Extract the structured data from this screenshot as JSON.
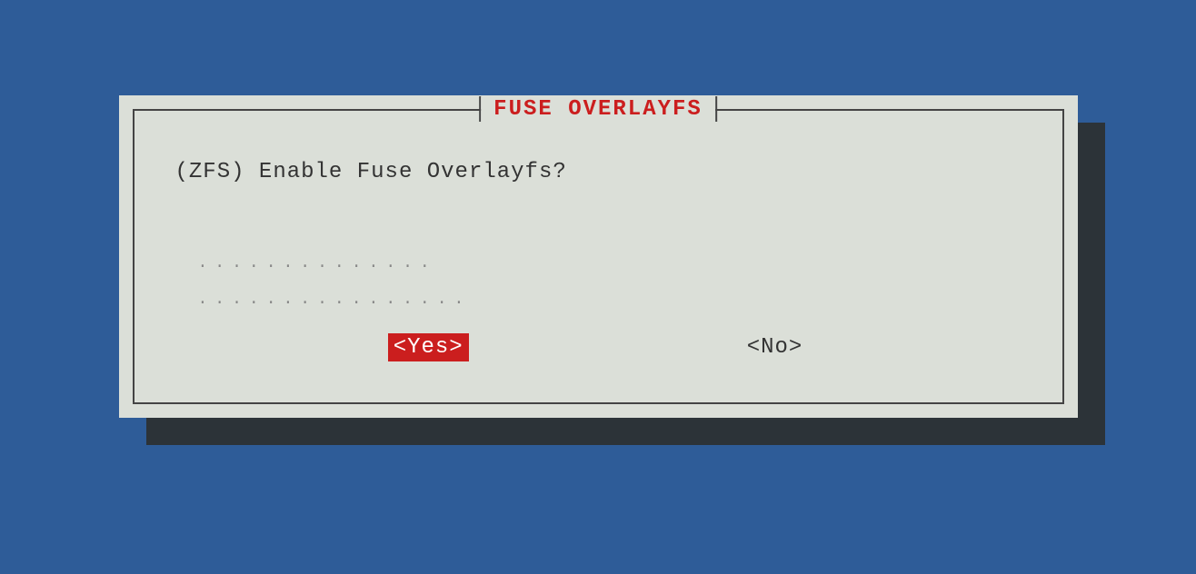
{
  "dialog": {
    "title": "FUSE OVERLAYFS",
    "message": "(ZFS) Enable Fuse Overlayfs?",
    "dots_line1": "..............",
    "dots_line2": "................",
    "buttons": {
      "yes": "<Yes>",
      "no": "<No>"
    },
    "selected": "yes"
  },
  "colors": {
    "background": "#2e5c98",
    "dialog_bg": "#dbdfd8",
    "shadow": "#2c3338",
    "accent": "#cb1e1e",
    "border": "#444444"
  }
}
